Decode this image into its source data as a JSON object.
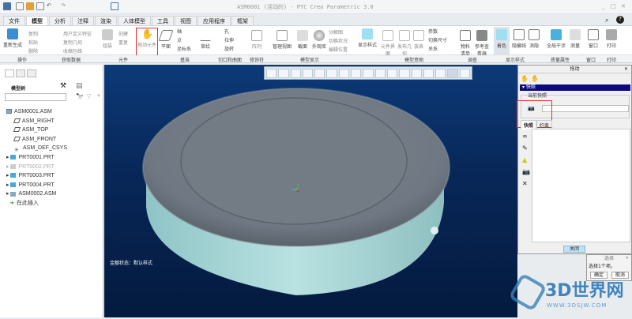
{
  "title": "ASM0001 (活动的) - PTC Creo Parametric 3.0",
  "tabs": [
    "文件",
    "模型",
    "分析",
    "注释",
    "渲染",
    "人体模型",
    "工具",
    "视图",
    "应用程序",
    "框架"
  ],
  "ribbon": {
    "buttons": [
      "重新生成",
      "复制",
      "粘贴",
      "删除",
      "用户定义特征",
      "复制几何",
      "收缩包络",
      "组装",
      "创建",
      "重复",
      "拖动元件",
      "平面",
      "轴",
      "点",
      "坐标系",
      "草绘",
      "孔",
      "拉伸",
      "旋转",
      "阵列",
      "管理视图",
      "截面",
      "外观库",
      "分解图",
      "切换状况",
      "编辑位置",
      "显示样式",
      "元件界面",
      "发布几何",
      "族表",
      "参数",
      "切换尺寸",
      "关系",
      "物料清单",
      "参考查看器",
      "着色",
      "隐藏线",
      "消隐",
      "全局干涉",
      "测量",
      "窗口",
      "打印"
    ],
    "groups": [
      "操作",
      "获取数据",
      "元件",
      "基准",
      "切口和曲面",
      "修饰符",
      "模型显示",
      "模型意图",
      "调查",
      "显示样式",
      "质量属性",
      "窗口",
      "打印"
    ]
  },
  "left": {
    "title": "模型树",
    "search_placeholder": "",
    "tree": [
      "ASM0001.ASM",
      "ASM_RIGHT",
      "ASM_TOP",
      "ASM_FRONT",
      "ASM_DEF_CSYS",
      "PRT0001.PRT",
      "PRT0002.PRT",
      "PRT0003.PRT",
      "PRT0004.PRT",
      "ASM0002.ASM",
      "在此插入"
    ]
  },
  "viewport": {
    "status": "金额状态：默认样式"
  },
  "drag_dialog": {
    "title": "拖动",
    "section": "快照",
    "current": "当前快照",
    "tabs": [
      "快照",
      "约束"
    ],
    "close": "关闭"
  },
  "select_dialog": {
    "title": "选择",
    "message": "选择1个项。",
    "ok": "确定",
    "cancel": "取消"
  },
  "watermark": {
    "text": "3D世界网",
    "url": "WWW.3DSJW.COM"
  },
  "colors": {
    "accent": "#0a0a7a",
    "viewport": "#08285a",
    "highlight": "#d33"
  }
}
